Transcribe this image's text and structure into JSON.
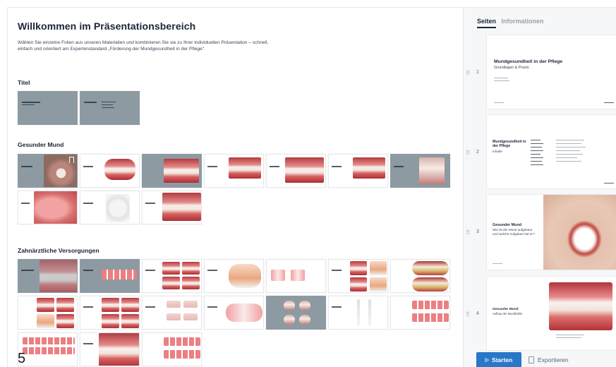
{
  "main": {
    "title": "Willkommen im Präsentationsbereich",
    "intro": "Wählen Sie einzelne Folien aus unseren Materialien und kombinieren Sie sie zu Ihrer individuellen Präsentation – schnell, einfach und orientiert am Expertenstandard „Förderung der Mundgesundheit in der Pflege“.",
    "sections": [
      {
        "title": "Titel"
      },
      {
        "title": "Gesunder Mund"
      },
      {
        "title": "Zahnärztliche Versorgungen"
      }
    ]
  },
  "figure_number": "5",
  "sidebar": {
    "tabs": [
      {
        "label": "Seiten",
        "active": true
      },
      {
        "label": "Informationen",
        "active": false
      }
    ],
    "slides": [
      {
        "number": "1",
        "title": "Mundgesundheit in der Pflege",
        "subtitle": "Grundlagen & Praxis"
      },
      {
        "number": "2",
        "title": "Mundgesundheit in der Pflege",
        "subtitle": "Inhalte"
      },
      {
        "number": "3",
        "title": "Gesunder Mund",
        "subtitle": "Wie ist der Mund aufgebaut und welche Aufgaben hat er?"
      },
      {
        "number": "4",
        "title": "Gesunder Mund",
        "subtitle": "Aufbau der Mundhöhle"
      }
    ],
    "start_label": "Starten",
    "export_label": "Exportieren"
  },
  "colors": {
    "accent": "#2877c9",
    "slide_gray": "#8e9aa2"
  }
}
